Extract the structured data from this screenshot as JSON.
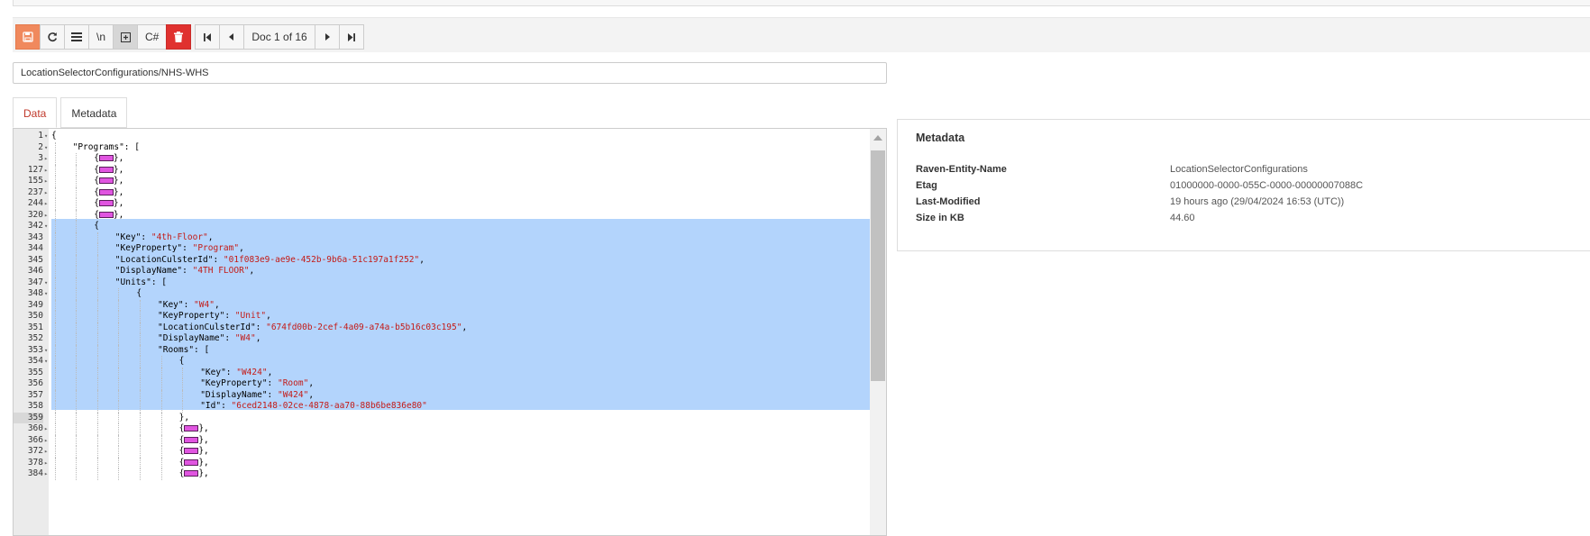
{
  "toolbar": {
    "buttons": [
      {
        "label": "",
        "icon": "floppy-disk-icon"
      },
      {
        "label": "",
        "icon": "refresh-icon"
      },
      {
        "label": "",
        "icon": "list-icon"
      },
      {
        "label": "\\n",
        "icon": ""
      },
      {
        "label": "",
        "icon": "expand-square-icon"
      },
      {
        "label": "C#",
        "icon": ""
      },
      {
        "label": "",
        "icon": "trash-icon"
      }
    ],
    "nav_label": "Doc 1 of 16"
  },
  "document_id": "LocationSelectorConfigurations/NHS-WHS",
  "tabs": [
    {
      "label": "Data"
    },
    {
      "label": "Metadata"
    }
  ],
  "metadata": {
    "title": "Metadata",
    "rows": [
      {
        "key": "Raven-Entity-Name",
        "value": "LocationSelectorConfigurations"
      },
      {
        "key": "Etag",
        "value": "01000000-0000-055C-0000-00000007088C"
      },
      {
        "key": "Last-Modified",
        "value": "19 hours ago (29/04/2024 16:53 (UTC))"
      },
      {
        "key": "Size in KB",
        "value": "44.60"
      }
    ]
  },
  "editor": {
    "lines": [
      {
        "n": "1",
        "f": "▾",
        "i": 0,
        "t": [
          [
            "p",
            "{"
          ]
        ]
      },
      {
        "n": "2",
        "f": "▾",
        "i": 1,
        "t": [
          [
            "p",
            "\"Programs\": ["
          ]
        ]
      },
      {
        "n": "3",
        "f": "▸",
        "i": 2,
        "t": [
          [
            "p",
            "{"
          ],
          [
            "m",
            ""
          ],
          [
            "p",
            "},"
          ]
        ]
      },
      {
        "n": "127",
        "f": "▸",
        "i": 2,
        "t": [
          [
            "p",
            "{"
          ],
          [
            "m",
            ""
          ],
          [
            "p",
            "},"
          ]
        ]
      },
      {
        "n": "155",
        "f": "▸",
        "i": 2,
        "t": [
          [
            "p",
            "{"
          ],
          [
            "m",
            ""
          ],
          [
            "p",
            "},"
          ]
        ]
      },
      {
        "n": "237",
        "f": "▸",
        "i": 2,
        "t": [
          [
            "p",
            "{"
          ],
          [
            "m",
            ""
          ],
          [
            "p",
            "},"
          ]
        ]
      },
      {
        "n": "244",
        "f": "▸",
        "i": 2,
        "t": [
          [
            "p",
            "{"
          ],
          [
            "m",
            ""
          ],
          [
            "p",
            "},"
          ]
        ]
      },
      {
        "n": "320",
        "f": "▸",
        "i": 2,
        "t": [
          [
            "p",
            "{"
          ],
          [
            "m",
            ""
          ],
          [
            "p",
            "},"
          ]
        ]
      },
      {
        "n": "342",
        "f": "▾",
        "i": 2,
        "t": [
          [
            "p",
            "{"
          ]
        ]
      },
      {
        "n": "343",
        "f": "",
        "i": 3,
        "t": [
          [
            "p",
            "\"Key\": "
          ],
          [
            "s",
            "\"4th-Floor\""
          ],
          [
            "p",
            ","
          ]
        ]
      },
      {
        "n": "344",
        "f": "",
        "i": 3,
        "t": [
          [
            "p",
            "\"KeyProperty\": "
          ],
          [
            "s",
            "\"Program\""
          ],
          [
            "p",
            ","
          ]
        ]
      },
      {
        "n": "345",
        "f": "",
        "i": 3,
        "t": [
          [
            "p",
            "\"LocationCulsterId\": "
          ],
          [
            "s",
            "\"01f083e9-ae9e-452b-9b6a-51c197a1f252\""
          ],
          [
            "p",
            ","
          ]
        ]
      },
      {
        "n": "346",
        "f": "",
        "i": 3,
        "t": [
          [
            "p",
            "\"DisplayName\": "
          ],
          [
            "s",
            "\"4TH FLOOR\""
          ],
          [
            "p",
            ","
          ]
        ]
      },
      {
        "n": "347",
        "f": "▾",
        "i": 3,
        "t": [
          [
            "p",
            "\"Units\": ["
          ]
        ]
      },
      {
        "n": "348",
        "f": "▾",
        "i": 4,
        "t": [
          [
            "p",
            "{"
          ]
        ]
      },
      {
        "n": "349",
        "f": "",
        "i": 5,
        "t": [
          [
            "p",
            "\"Key\": "
          ],
          [
            "s",
            "\"W4\""
          ],
          [
            "p",
            ","
          ]
        ]
      },
      {
        "n": "350",
        "f": "",
        "i": 5,
        "t": [
          [
            "p",
            "\"KeyProperty\": "
          ],
          [
            "s",
            "\"Unit\""
          ],
          [
            "p",
            ","
          ]
        ]
      },
      {
        "n": "351",
        "f": "",
        "i": 5,
        "t": [
          [
            "p",
            "\"LocationCulsterId\": "
          ],
          [
            "s",
            "\"674fd00b-2cef-4a09-a74a-b5b16c03c195\""
          ],
          [
            "p",
            ","
          ]
        ]
      },
      {
        "n": "352",
        "f": "",
        "i": 5,
        "t": [
          [
            "p",
            "\"DisplayName\": "
          ],
          [
            "s",
            "\"W4\""
          ],
          [
            "p",
            ","
          ]
        ]
      },
      {
        "n": "353",
        "f": "▾",
        "i": 5,
        "t": [
          [
            "p",
            "\"Rooms\": ["
          ]
        ]
      },
      {
        "n": "354",
        "f": "▾",
        "i": 6,
        "t": [
          [
            "p",
            "{"
          ]
        ]
      },
      {
        "n": "355",
        "f": "",
        "i": 7,
        "t": [
          [
            "p",
            "\"Key\": "
          ],
          [
            "s",
            "\"W424\""
          ],
          [
            "p",
            ","
          ]
        ]
      },
      {
        "n": "356",
        "f": "",
        "i": 7,
        "t": [
          [
            "p",
            "\"KeyProperty\": "
          ],
          [
            "s",
            "\"Room\""
          ],
          [
            "p",
            ","
          ]
        ]
      },
      {
        "n": "357",
        "f": "",
        "i": 7,
        "t": [
          [
            "p",
            "\"DisplayName\": "
          ],
          [
            "s",
            "\"W424\""
          ],
          [
            "p",
            ","
          ]
        ]
      },
      {
        "n": "358",
        "f": "",
        "i": 7,
        "t": [
          [
            "p",
            "\"Id\": "
          ],
          [
            "s",
            "\"6ced2148-02ce-4878-aa70-88b6be836e80\""
          ]
        ]
      },
      {
        "n": "359",
        "f": "",
        "i": 6,
        "t": [
          [
            "p",
            "},"
          ]
        ]
      },
      {
        "n": "360",
        "f": "▸",
        "i": 6,
        "t": [
          [
            "p",
            "{"
          ],
          [
            "m",
            ""
          ],
          [
            "p",
            "},"
          ]
        ]
      },
      {
        "n": "366",
        "f": "▸",
        "i": 6,
        "t": [
          [
            "p",
            "{"
          ],
          [
            "m",
            ""
          ],
          [
            "p",
            "},"
          ]
        ]
      },
      {
        "n": "372",
        "f": "▸",
        "i": 6,
        "t": [
          [
            "p",
            "{"
          ],
          [
            "m",
            ""
          ],
          [
            "p",
            "},"
          ]
        ]
      },
      {
        "n": "378",
        "f": "▸",
        "i": 6,
        "t": [
          [
            "p",
            "{"
          ],
          [
            "m",
            ""
          ],
          [
            "p",
            "},"
          ]
        ]
      },
      {
        "n": "384",
        "f": "▸",
        "i": 6,
        "t": [
          [
            "p",
            "{"
          ],
          [
            "m",
            ""
          ],
          [
            "p",
            "},"
          ]
        ]
      }
    ],
    "current_line": "359"
  }
}
